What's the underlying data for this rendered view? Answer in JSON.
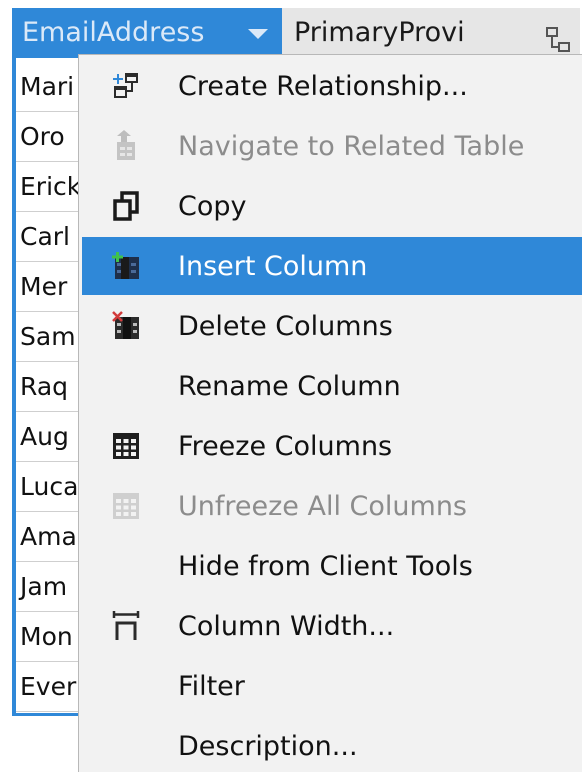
{
  "grid": {
    "columns": [
      {
        "label": "EmailAddress"
      },
      {
        "label": "PrimaryProvi"
      }
    ],
    "rows": [
      "Mari",
      "Oro",
      "Erick",
      "Carl",
      "Mer",
      "Sam",
      "Raq",
      "Aug",
      "Luca",
      "Ama",
      "Jam",
      "Mon",
      "Ever"
    ]
  },
  "menu": {
    "items": [
      {
        "label": "Create Relationship...",
        "icon": "create-relationship-icon",
        "enabled": true
      },
      {
        "label": "Navigate to Related Table",
        "icon": "navigate-related-icon",
        "enabled": false
      },
      {
        "label": "Copy",
        "icon": "copy-icon",
        "enabled": true
      },
      {
        "label": "Insert Column",
        "icon": "insert-column-icon",
        "enabled": true,
        "highlighted": true
      },
      {
        "label": "Delete Columns",
        "icon": "delete-columns-icon",
        "enabled": true
      },
      {
        "label": "Rename Column",
        "icon": "",
        "enabled": true
      },
      {
        "label": "Freeze Columns",
        "icon": "freeze-columns-icon",
        "enabled": true
      },
      {
        "label": "Unfreeze All Columns",
        "icon": "unfreeze-columns-icon",
        "enabled": false
      },
      {
        "label": "Hide from Client Tools",
        "icon": "",
        "enabled": true
      },
      {
        "label": "Column Width...",
        "icon": "column-width-icon",
        "enabled": true
      },
      {
        "label": "Filter",
        "icon": "",
        "enabled": true
      },
      {
        "label": "Description...",
        "icon": "",
        "enabled": true
      }
    ]
  },
  "colors": {
    "accent": "#2f88d8",
    "menu_bg": "#f2f2f2",
    "disabled_text": "#8c8c8c"
  }
}
